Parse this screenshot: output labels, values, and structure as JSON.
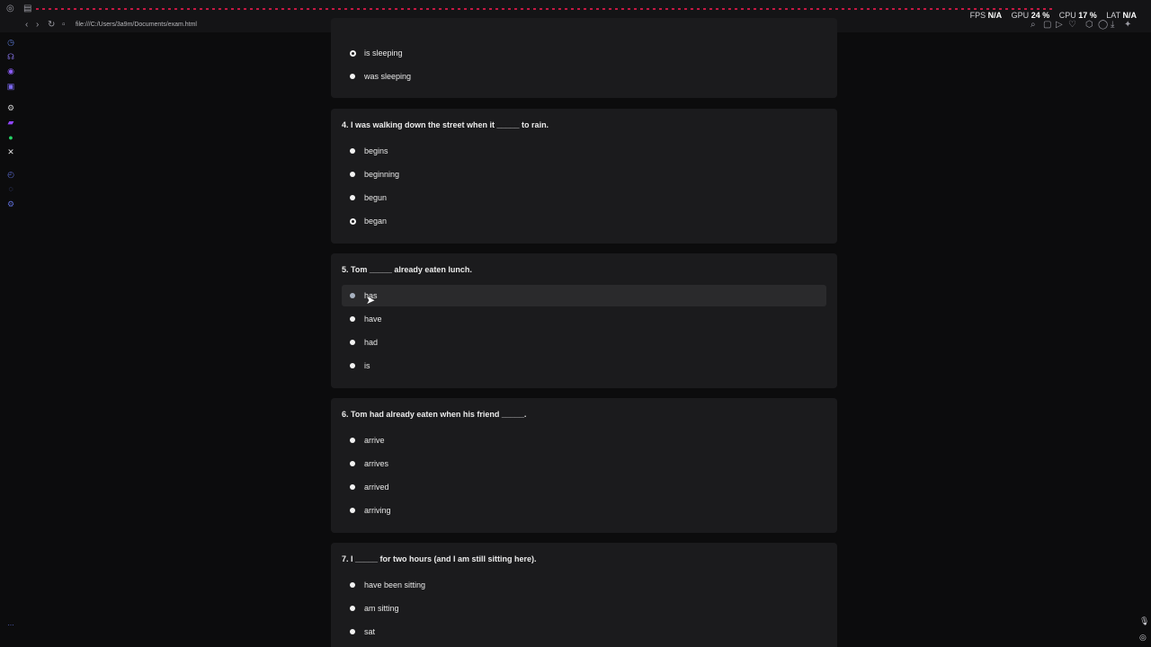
{
  "browser": {
    "url": "file:///C:/Users/3a9m/Documents/exam.html",
    "accent_color": "#c41843"
  },
  "perf": {
    "fps_label": "FPS",
    "fps_value": "N/A",
    "gpu_label": "GPU",
    "gpu_value": "24 %",
    "cpu_label": "CPU",
    "cpu_value": "17 %",
    "lat_label": "LAT",
    "lat_value": "N/A"
  },
  "questions": [
    {
      "title": "",
      "options": [
        "is sleeping",
        "was sleeping"
      ]
    },
    {
      "title": "4. I was walking down the street when it _____ to rain.",
      "options": [
        "begins",
        "beginning",
        "begun",
        "began"
      ]
    },
    {
      "title": "5. Tom _____ already eaten lunch.",
      "options": [
        "has",
        "have",
        "had",
        "is"
      ]
    },
    {
      "title": "6. Tom had already eaten when his friend _____.",
      "options": [
        "arrive",
        "arrives",
        "arrived",
        "arriving"
      ]
    },
    {
      "title": "7. I _____ for two hours (and I am still sitting here).",
      "options": [
        "have been sitting",
        "am sitting",
        "sat"
      ]
    }
  ]
}
